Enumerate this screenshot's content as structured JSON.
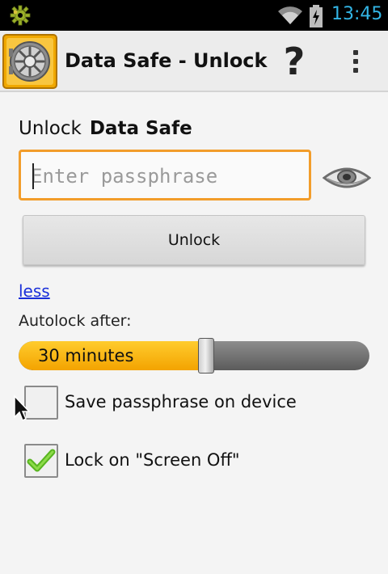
{
  "status_bar": {
    "time": "13:45",
    "icons": [
      "gear-notification-icon",
      "wifi-icon",
      "battery-charging-icon"
    ],
    "clock_color": "#33b5e5"
  },
  "action_bar": {
    "app_icon": "safe-icon",
    "title": "Data Safe - Unlock",
    "help_label": "?",
    "menu_icon": "overflow-menu-icon"
  },
  "unlock_form": {
    "heading_prefix": "Unlock",
    "heading_name": "Data Safe",
    "passphrase_placeholder": "Enter passphrase",
    "passphrase_value": "",
    "show_passphrase_icon": "eye-icon",
    "unlock_button_label": "Unlock",
    "less_link_label": "less",
    "accent_color": "#f29d2b"
  },
  "autolock": {
    "label": "Autolock after:",
    "value_text": "30 minutes",
    "slider_fraction": 0.54,
    "fill_color": "#f3a300"
  },
  "options": [
    {
      "label": "Save passphrase on device",
      "checked": false
    },
    {
      "label": "Lock on \"Screen Off\"",
      "checked": true
    }
  ]
}
